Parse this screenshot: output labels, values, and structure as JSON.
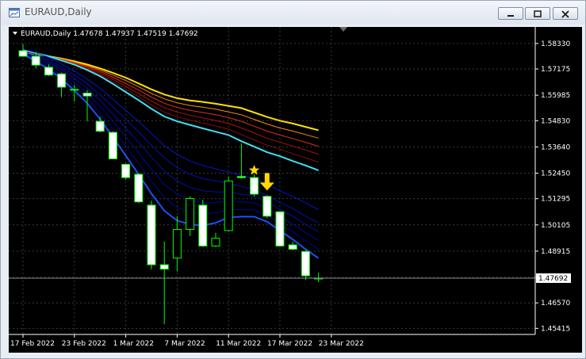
{
  "window": {
    "title": "EURAUD,Daily"
  },
  "titlebar_buttons": [
    {
      "name": "minimize-button",
      "icon": "minimize-icon"
    },
    {
      "name": "maximize-button",
      "icon": "maximize-icon"
    },
    {
      "name": "close-button",
      "icon": "close-icon"
    }
  ],
  "chart_info": {
    "header": "EURAUD,Daily  1.47678 1.47937 1.47519 1.47692",
    "current_price_label": "1.47692",
    "current_price": 1.47692
  },
  "colors": {
    "background": "#000000",
    "bull_candle": "#000000",
    "bear_candle": "#ffffff",
    "wick": "#00ff00",
    "grid": "#3a3a3a",
    "arrow": "#ffd800",
    "star": "#ffd800"
  },
  "annotations": [
    {
      "type": "star-icon",
      "candle": 18
    },
    {
      "type": "arrow-down-icon",
      "candle": 19
    }
  ],
  "chart_data": {
    "type": "candlestick",
    "title": "EURAUD,Daily",
    "ylim": [
      1.4514,
      1.5908
    ],
    "y_ticks": [
      "1.58330",
      "1.57175",
      "1.55985",
      "1.54830",
      "1.53640",
      "1.52450",
      "1.51295",
      "1.50105",
      "1.48915",
      "1.47725",
      "1.46570",
      "1.45415"
    ],
    "x_ticks": [
      {
        "label": "17 Feb 2022",
        "candle": 0
      },
      {
        "label": "23 Feb 2022",
        "candle": 4
      },
      {
        "label": "1 Mar 2022",
        "candle": 8
      },
      {
        "label": "7 Mar 2022",
        "candle": 12
      },
      {
        "label": "11 Mar 2022",
        "candle": 16
      },
      {
        "label": "17 Mar 2022",
        "candle": 20
      },
      {
        "label": "23 Mar 2022",
        "candle": 24
      }
    ],
    "candles": [
      {
        "open": 1.58,
        "high": 1.583,
        "low": 1.5778,
        "close": 1.5775
      },
      {
        "open": 1.5775,
        "high": 1.5795,
        "low": 1.572,
        "close": 1.5735
      },
      {
        "open": 1.5725,
        "high": 1.5738,
        "low": 1.5685,
        "close": 1.569
      },
      {
        "open": 1.5695,
        "high": 1.57,
        "low": 1.559,
        "close": 1.5635
      },
      {
        "open": 1.5622,
        "high": 1.5645,
        "low": 1.557,
        "close": 1.5625
      },
      {
        "open": 1.5608,
        "high": 1.5622,
        "low": 1.548,
        "close": 1.5595
      },
      {
        "open": 1.548,
        "high": 1.55,
        "low": 1.543,
        "close": 1.5435
      },
      {
        "open": 1.543,
        "high": 1.5435,
        "low": 1.531,
        "close": 1.531
      },
      {
        "open": 1.5285,
        "high": 1.529,
        "low": 1.5215,
        "close": 1.5225
      },
      {
        "open": 1.524,
        "high": 1.5245,
        "low": 1.511,
        "close": 1.5115
      },
      {
        "open": 1.51,
        "high": 1.512,
        "low": 1.481,
        "close": 1.483
      },
      {
        "open": 1.483,
        "high": 1.4935,
        "low": 1.456,
        "close": 1.481
      },
      {
        "open": 1.486,
        "high": 1.505,
        "low": 1.48,
        "close": 1.499
      },
      {
        "open": 1.499,
        "high": 1.514,
        "low": 1.496,
        "close": 1.513
      },
      {
        "open": 1.51,
        "high": 1.5125,
        "low": 1.491,
        "close": 1.4915
      },
      {
        "open": 1.4915,
        "high": 1.4975,
        "low": 1.491,
        "close": 1.495
      },
      {
        "open": 1.4985,
        "high": 1.523,
        "low": 1.498,
        "close": 1.521
      },
      {
        "open": 1.523,
        "high": 1.538,
        "low": 1.522,
        "close": 1.5225
      },
      {
        "open": 1.5225,
        "high": 1.524,
        "low": 1.514,
        "close": 1.515
      },
      {
        "open": 1.514,
        "high": 1.5145,
        "low": 1.504,
        "close": 1.505
      },
      {
        "open": 1.507,
        "high": 1.507,
        "low": 1.491,
        "close": 1.4915
      },
      {
        "open": 1.492,
        "high": 1.4935,
        "low": 1.4895,
        "close": 1.49
      },
      {
        "open": 1.489,
        "high": 1.4895,
        "low": 1.476,
        "close": 1.478
      },
      {
        "open": 1.47678,
        "high": 1.47937,
        "low": 1.47519,
        "close": 1.47692
      }
    ],
    "moving_averages": [
      {
        "color": "#ffe000",
        "values": [
          1.579,
          1.5785,
          1.5775,
          1.5765,
          1.5752,
          1.5738,
          1.572,
          1.57,
          1.5678,
          1.5652,
          1.5625,
          1.5602,
          1.5585,
          1.5575,
          1.5568,
          1.556,
          1.555,
          1.554,
          1.552,
          1.55,
          1.5483,
          1.547,
          1.5455,
          1.544
        ]
      },
      {
        "color": "#ff8c00",
        "values": [
          1.5792,
          1.5786,
          1.5775,
          1.5763,
          1.5749,
          1.5733,
          1.5713,
          1.569,
          1.5665,
          1.5637,
          1.5607,
          1.5582,
          1.5564,
          1.5552,
          1.5544,
          1.5535,
          1.5523,
          1.551,
          1.5489,
          1.5468,
          1.545,
          1.5436,
          1.542,
          1.5404
        ]
      },
      {
        "color": "#e03010",
        "values": [
          1.5795,
          1.5787,
          1.5775,
          1.5761,
          1.5746,
          1.5728,
          1.5706,
          1.568,
          1.5652,
          1.5622,
          1.559,
          1.5562,
          1.5543,
          1.553,
          1.552,
          1.551,
          1.5497,
          1.548,
          1.5458,
          1.5436,
          1.5418,
          1.5402,
          1.5385,
          1.5367
        ]
      },
      {
        "color": "#b01010",
        "values": [
          1.5797,
          1.5788,
          1.5775,
          1.5759,
          1.5743,
          1.5723,
          1.5699,
          1.567,
          1.5639,
          1.5606,
          1.5572,
          1.5542,
          1.5522,
          1.5508,
          1.5496,
          1.5484,
          1.547,
          1.545,
          1.5427,
          1.5404,
          1.5386,
          1.5368,
          1.535,
          1.5331
        ]
      },
      {
        "color": "#801010",
        "values": [
          1.58,
          1.5789,
          1.5775,
          1.5758,
          1.574,
          1.5718,
          1.5692,
          1.566,
          1.5626,
          1.5591,
          1.5555,
          1.5522,
          1.5501,
          1.5486,
          1.5472,
          1.5459,
          1.5444,
          1.542,
          1.5396,
          1.5372,
          1.5354,
          1.5334,
          1.5315,
          1.5294
        ]
      },
      {
        "color": "#40e0f0",
        "values": [
          1.5802,
          1.579,
          1.5775,
          1.5756,
          1.5737,
          1.5713,
          1.5685,
          1.565,
          1.5613,
          1.5576,
          1.5537,
          1.5502,
          1.548,
          1.5464,
          1.5448,
          1.5433,
          1.5418,
          1.539,
          1.5365,
          1.534,
          1.5322,
          1.53,
          1.528,
          1.5258
        ]
      },
      {
        "color": "#0018d0",
        "values": [
          1.5808,
          1.5792,
          1.577,
          1.574,
          1.5708,
          1.5672,
          1.563,
          1.558,
          1.553,
          1.548,
          1.5425,
          1.537,
          1.533,
          1.53,
          1.528,
          1.5265,
          1.525,
          1.5235,
          1.522,
          1.5195,
          1.5165,
          1.514,
          1.511,
          1.508
        ]
      },
      {
        "color": "#0010c0",
        "values": [
          1.58,
          1.5783,
          1.576,
          1.5727,
          1.569,
          1.565,
          1.56,
          1.5545,
          1.549,
          1.5432,
          1.5372,
          1.5315,
          1.527,
          1.524,
          1.522,
          1.521,
          1.52,
          1.5185,
          1.517,
          1.5145,
          1.5112,
          1.5085,
          1.505,
          1.502
        ]
      },
      {
        "color": "#0010b0",
        "values": [
          1.5795,
          1.5775,
          1.575,
          1.5715,
          1.5675,
          1.563,
          1.5575,
          1.5513,
          1.545,
          1.5385,
          1.5318,
          1.5255,
          1.521,
          1.518,
          1.5165,
          1.516,
          1.516,
          1.515,
          1.514,
          1.5115,
          1.508,
          1.505,
          1.5012,
          1.498
        ]
      },
      {
        "color": "#0008a0",
        "values": [
          1.579,
          1.5768,
          1.574,
          1.5702,
          1.5658,
          1.5608,
          1.5548,
          1.548,
          1.541,
          1.5338,
          1.5263,
          1.5195,
          1.515,
          1.5123,
          1.511,
          1.5112,
          1.512,
          1.5115,
          1.511,
          1.5085,
          1.5048,
          1.5015,
          1.4975,
          1.494
        ]
      },
      {
        "color": "#000890",
        "values": [
          1.5788,
          1.576,
          1.5728,
          1.5688,
          1.564,
          1.5586,
          1.552,
          1.5445,
          1.5368,
          1.529,
          1.5208,
          1.5135,
          1.509,
          1.5068,
          1.5058,
          1.5065,
          1.508,
          1.508,
          1.5078,
          1.5055,
          1.5016,
          1.498,
          1.4938,
          1.49
        ]
      },
      {
        "color": "#1a50ff",
        "values": [
          1.5785,
          1.5752,
          1.5716,
          1.5672,
          1.562,
          1.5562,
          1.549,
          1.5408,
          1.5325,
          1.524,
          1.5152,
          1.5075,
          1.503,
          1.5013,
          1.5008,
          1.502,
          1.5045,
          1.5048,
          1.5048,
          1.5025,
          1.4985,
          1.4945,
          1.49,
          1.486
        ]
      }
    ]
  }
}
